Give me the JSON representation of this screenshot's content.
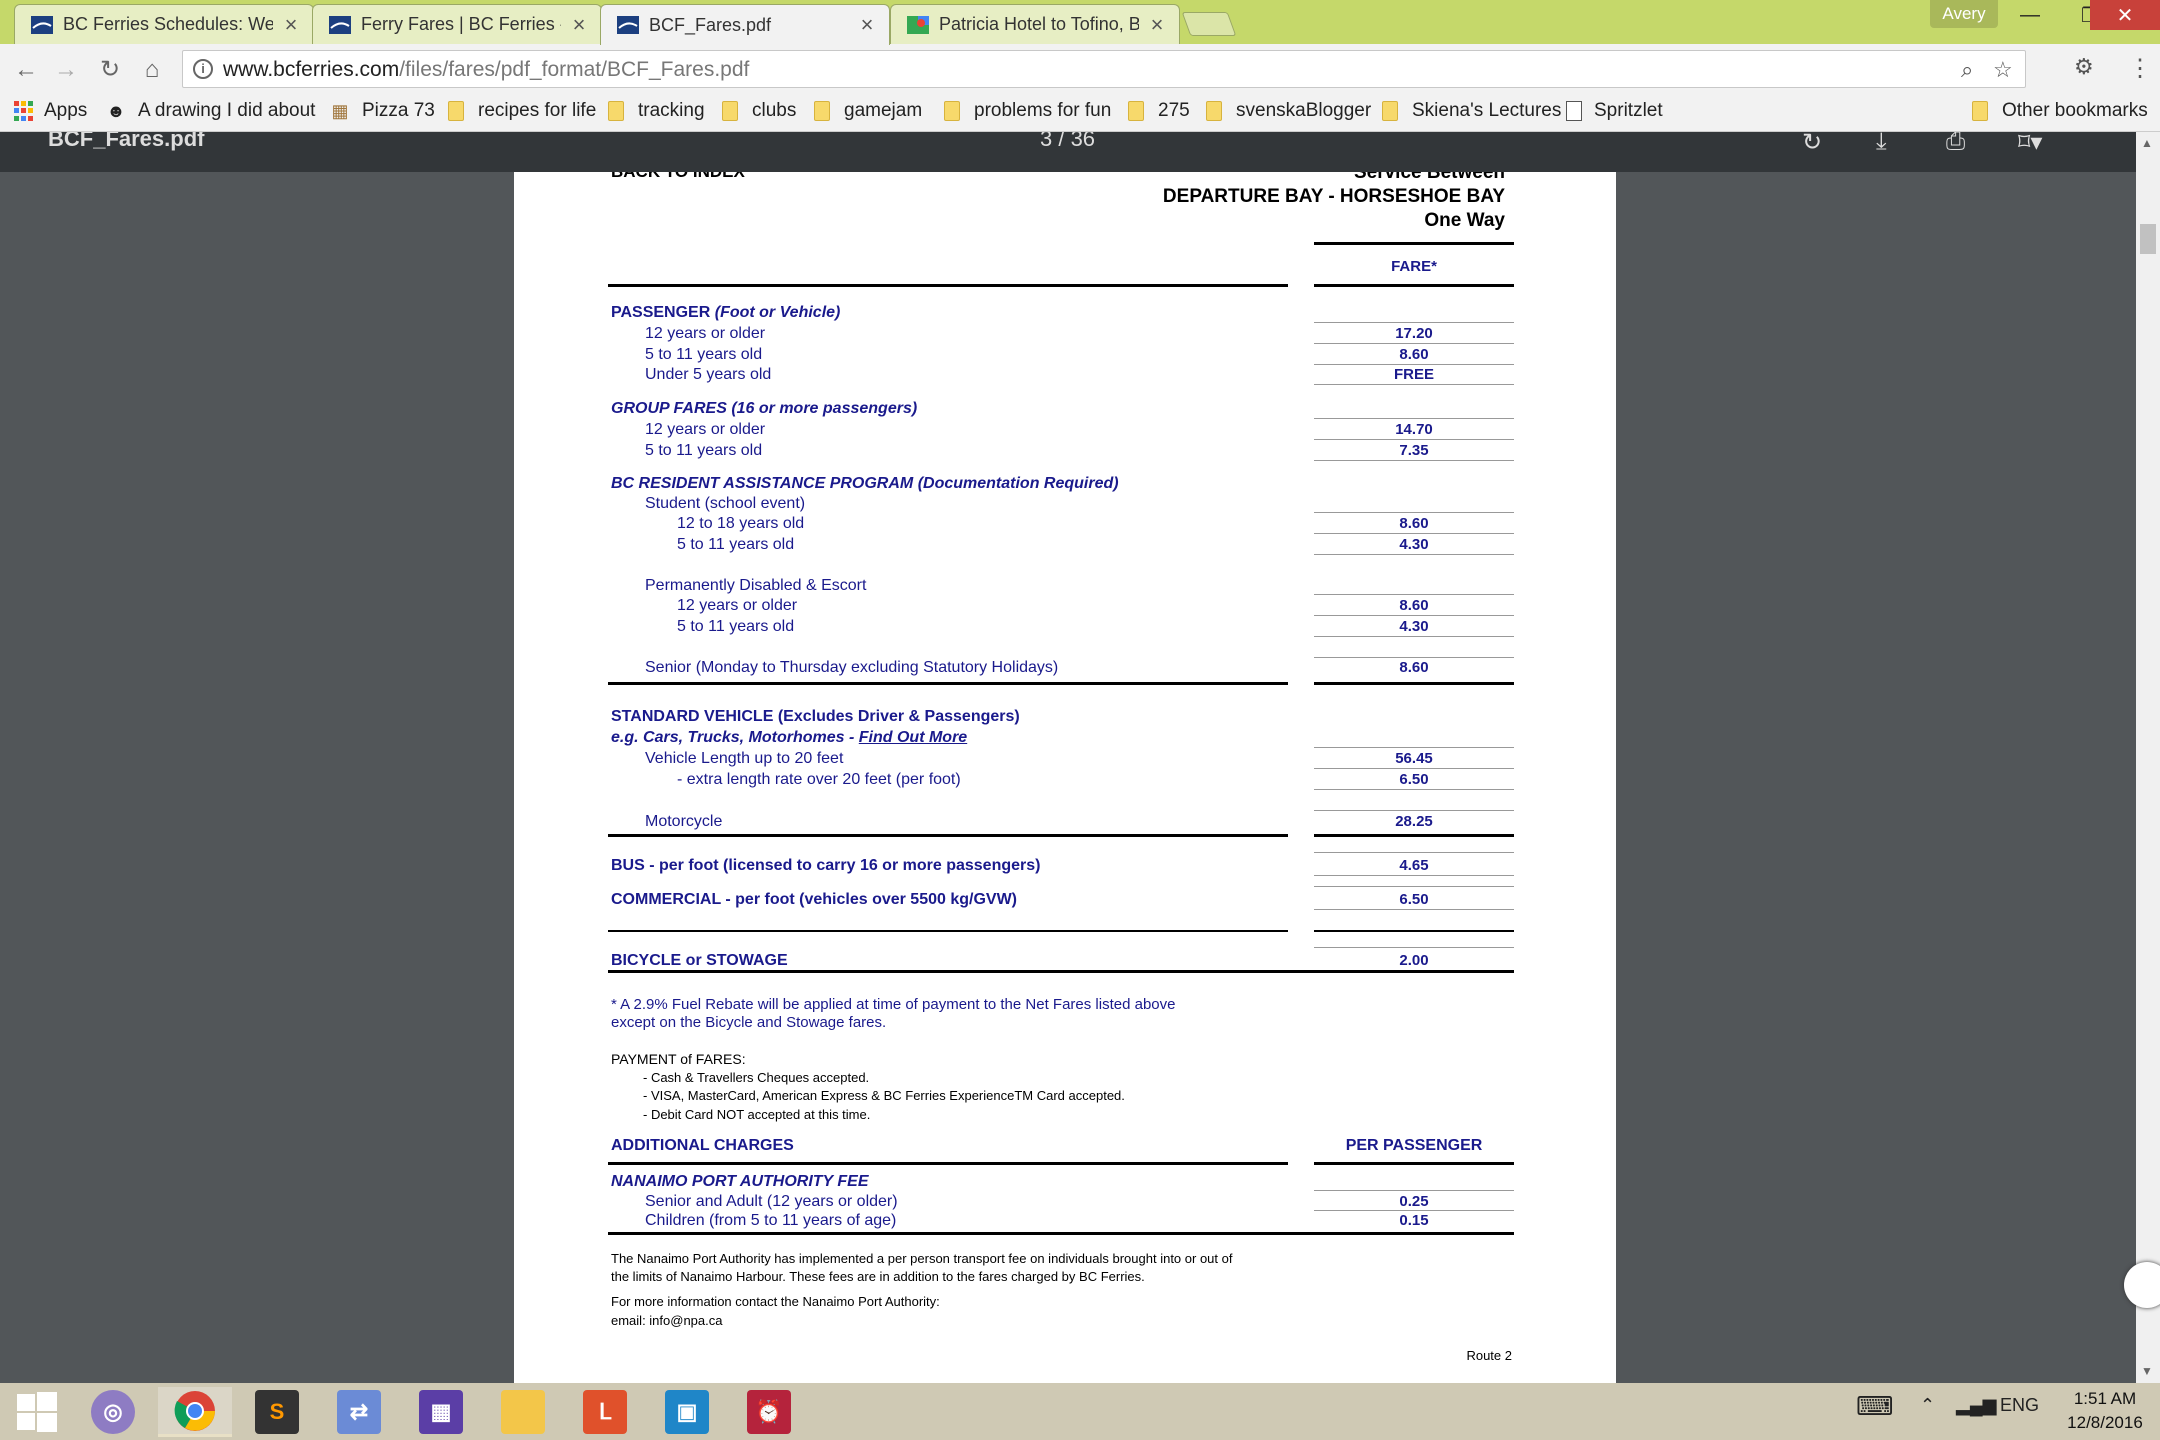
{
  "browser": {
    "tabs": [
      {
        "title": "BC Ferries Schedules: We",
        "favicon": "bcferries-icon"
      },
      {
        "title": "Ferry Fares | BC Ferries -",
        "favicon": "bcferries-icon"
      },
      {
        "title": "BCF_Fares.pdf",
        "favicon": "bcferries-icon",
        "active": true
      },
      {
        "title": "Patricia Hotel to Tofino, B",
        "favicon": "maps-icon"
      }
    ],
    "profile": "Avery",
    "url_domain": "www.bcferries.com",
    "url_path": "/files/fares/pdf_format/BCF_Fares.pdf",
    "bookmarks": [
      {
        "label": "Apps",
        "icon": "apps-grid-icon"
      },
      {
        "label": "A drawing I did about",
        "icon": "site-icon"
      },
      {
        "label": "Pizza 73",
        "icon": "site-icon"
      },
      {
        "label": "recipes for life",
        "icon": "folder-icon"
      },
      {
        "label": "tracking",
        "icon": "folder-icon"
      },
      {
        "label": "clubs",
        "icon": "folder-icon"
      },
      {
        "label": "gamejam",
        "icon": "folder-icon"
      },
      {
        "label": "problems for fun",
        "icon": "folder-icon"
      },
      {
        "label": "275",
        "icon": "folder-icon"
      },
      {
        "label": "svenskaBlogger",
        "icon": "folder-icon"
      },
      {
        "label": "Skiena's Lectures",
        "icon": "folder-icon"
      },
      {
        "label": "Spritzlet",
        "icon": "page-icon"
      },
      {
        "label": "Other bookmarks",
        "icon": "folder-icon"
      }
    ]
  },
  "pdf": {
    "filename": "BCF_Fares.pdf",
    "page_indicator": "3 / 36",
    "doc": {
      "back_to_index": "BACK TO INDEX",
      "service_between": "Service Between",
      "route_name": "DEPARTURE BAY - HORSESHOE BAY",
      "one_way": "One Way",
      "fare_header": "FARE*",
      "passenger_heading": "PASSENGER",
      "passenger_sub": "(Foot or Vehicle)",
      "p_12_older": "12 years or older",
      "p_12_older_fare": "17.20",
      "p_5_11": "5 to 11 years old",
      "p_5_11_fare": "8.60",
      "p_under5": "Under 5 years old",
      "p_under5_fare": "FREE",
      "group_heading": "GROUP FARES (16 or more passengers)",
      "g_12_older": "12 years or older",
      "g_12_older_fare": "14.70",
      "g_5_11": "5 to 11 years old",
      "g_5_11_fare": "7.35",
      "resident_heading": "BC RESIDENT ASSISTANCE PROGRAM (Documentation Required)",
      "student": "Student (school event)",
      "s_12_18": "12 to 18 years old",
      "s_12_18_fare": "8.60",
      "s_5_11": "5 to 11 years old",
      "s_5_11_fare": "4.30",
      "disabled": "Permanently Disabled & Escort",
      "d_12_older": "12 years or older",
      "d_12_older_fare": "8.60",
      "d_5_11": "5 to 11 years old",
      "d_5_11_fare": "4.30",
      "senior": "Senior (Monday to Thursday excluding Statutory Holidays)",
      "senior_fare": "8.60",
      "vehicle_heading": "STANDARD VEHICLE  (Excludes Driver & Passengers)",
      "vehicle_eg": "e.g. Cars, Trucks, Motorhomes - ",
      "find_out_more": "Find Out More",
      "vehicle_20": "Vehicle Length up to 20 feet",
      "vehicle_20_fare": "56.45",
      "extra_length": "- extra length rate over 20 feet (per foot)",
      "extra_length_fare": "6.50",
      "motorcycle": "Motorcycle",
      "motorcycle_fare": "28.25",
      "bus": "BUS - per foot (licensed to carry 16 or more passengers)",
      "bus_fare": "4.65",
      "commercial": "COMMERCIAL - per foot (vehicles over 5500 kg/GVW)",
      "commercial_fare": "6.50",
      "bicycle": "BICYCLE or STOWAGE",
      "bicycle_fare": "2.00",
      "rebate_1": "* A 2.9% Fuel Rebate will be applied at time of payment to the Net Fares listed above",
      "rebate_2": "except on the Bicycle and Stowage fares.",
      "payment_heading": "PAYMENT of FARES:",
      "pay_1": "- Cash & Travellers Cheques accepted.",
      "pay_2": "- VISA, MasterCard, American Express & BC Ferries ExperienceTM Card accepted.",
      "pay_3": "- Debit Card NOT accepted at this time.",
      "additional_heading": "ADDITIONAL CHARGES",
      "per_passenger": "PER PASSENGER",
      "nanaimo_heading": "NANAIMO PORT AUTHORITY FEE",
      "n_senior_adult": "Senior and Adult (12 years or older)",
      "n_senior_adult_fee": "0.25",
      "n_children": "Children (from 5 to 11 years of age)",
      "n_children_fee": "0.15",
      "note_1": "The Nanaimo Port Authority has implemented a per person transport fee on individuals brought into or out of",
      "note_2": "the limits of Nanaimo Harbour. These fees are in addition to the fares charged by BC Ferries.",
      "contact_1": "For more information contact the Nanaimo Port Authority:",
      "contact_2": "email: info@npa.ca",
      "route_footer": "Route 2"
    }
  },
  "taskbar": {
    "items": [
      "windows-start",
      "cortana",
      "chrome",
      "sublime-text",
      "network-app",
      "calendar-app",
      "file-explorer",
      "office-app",
      "photos-app",
      "alarms-app"
    ],
    "language": "ENG",
    "time": "1:51 AM",
    "date": "12/8/2016"
  }
}
